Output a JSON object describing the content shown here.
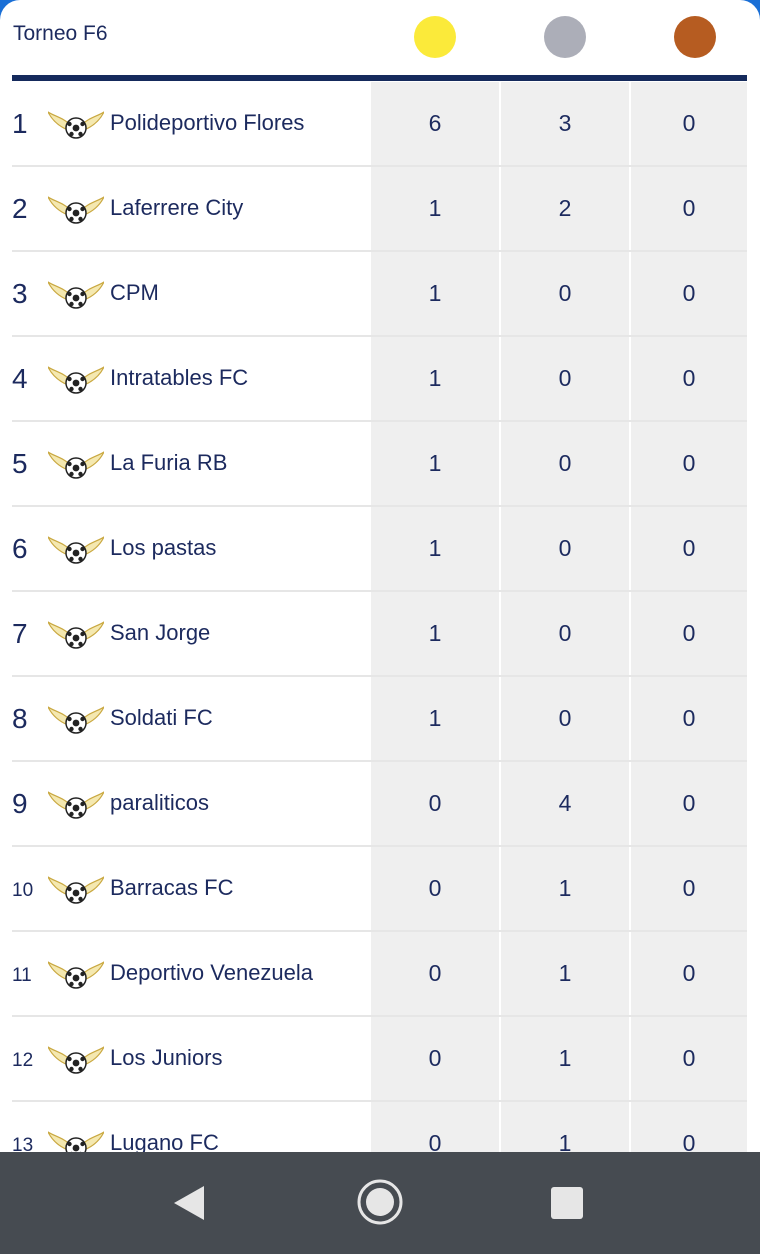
{
  "header": {
    "title": "Torneo F6",
    "medals": [
      {
        "name": "gold",
        "color": "#fbea3a"
      },
      {
        "name": "silver",
        "color": "#acaeb8"
      },
      {
        "name": "bronze",
        "color": "#b65c21"
      }
    ]
  },
  "rows": [
    {
      "pos": "1",
      "team": "Polideportivo Flores",
      "gold": "6",
      "silver": "3",
      "bronze": "0"
    },
    {
      "pos": "2",
      "team": "Laferrere City",
      "gold": "1",
      "silver": "2",
      "bronze": "0"
    },
    {
      "pos": "3",
      "team": "CPM",
      "gold": "1",
      "silver": "0",
      "bronze": "0"
    },
    {
      "pos": "4",
      "team": "Intratables FC",
      "gold": "1",
      "silver": "0",
      "bronze": "0"
    },
    {
      "pos": "5",
      "team": "La Furia RB",
      "gold": "1",
      "silver": "0",
      "bronze": "0"
    },
    {
      "pos": "6",
      "team": "Los pastas",
      "gold": "1",
      "silver": "0",
      "bronze": "0"
    },
    {
      "pos": "7",
      "team": "San Jorge",
      "gold": "1",
      "silver": "0",
      "bronze": "0"
    },
    {
      "pos": "8",
      "team": "Soldati FC",
      "gold": "1",
      "silver": "0",
      "bronze": "0"
    },
    {
      "pos": "9",
      "team": "paraliticos",
      "gold": "0",
      "silver": "4",
      "bronze": "0"
    },
    {
      "pos": "10",
      "team": "Barracas FC",
      "gold": "0",
      "silver": "1",
      "bronze": "0"
    },
    {
      "pos": "11",
      "team": "Deportivo Venezuela",
      "gold": "0",
      "silver": "1",
      "bronze": "0"
    },
    {
      "pos": "12",
      "team": "Los Juniors",
      "gold": "0",
      "silver": "1",
      "bronze": "0"
    },
    {
      "pos": "13",
      "team": "Lugano FC",
      "gold": "0",
      "silver": "1",
      "bronze": "0"
    }
  ],
  "colors": {
    "accent": "#152a5c",
    "text": "#1c2a5e",
    "cell_bg": "#efefef",
    "navbar": "#464b51"
  },
  "navbar": {
    "icons": [
      "back-icon",
      "home-icon",
      "recents-icon"
    ]
  }
}
